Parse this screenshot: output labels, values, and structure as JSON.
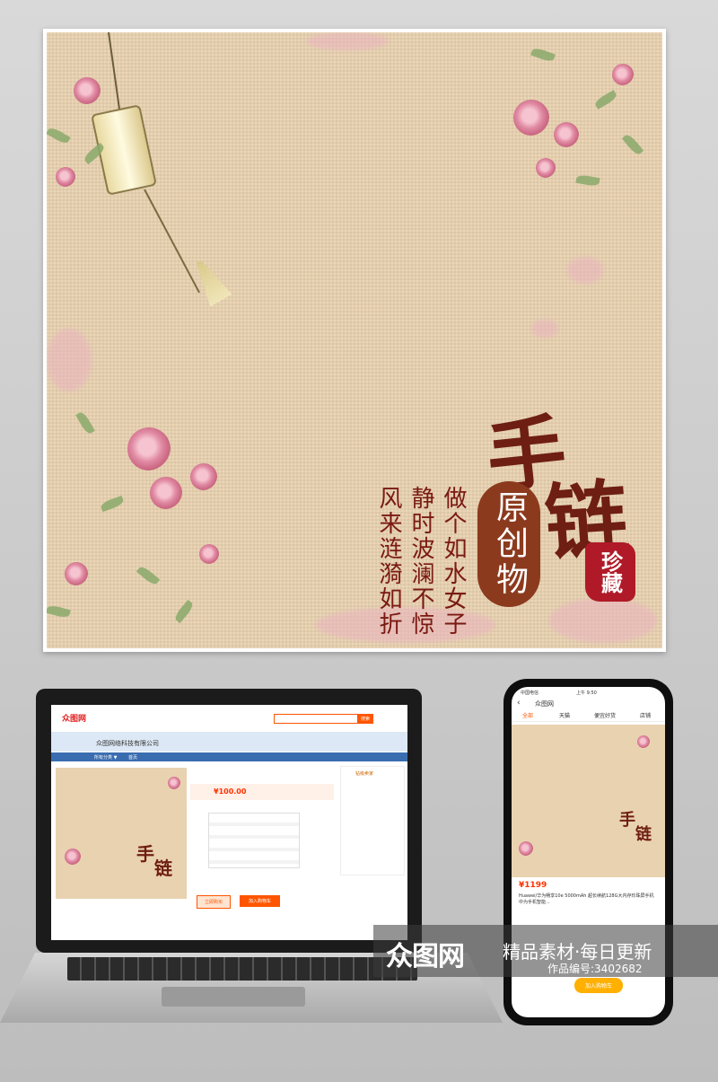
{
  "poster": {
    "title_char1": "手",
    "title_char2": "链",
    "circle_text": "原创物",
    "seal_text": "珍藏",
    "line1": "做个如水女子",
    "line2": "静时波澜不惊",
    "line3": "风来涟漪如折"
  },
  "laptop": {
    "logo": "众图网",
    "search_placeholder": "",
    "search_button": "搜索",
    "shop_name": "众图网络科技有限公司",
    "nav_items": [
      "所有分类 ▼",
      "首页"
    ],
    "price": "¥100.00",
    "buy_now": "立即购买",
    "add_cart": "加入购物车",
    "seller_label": "钻级卖家"
  },
  "phone": {
    "status_left": "中国电信",
    "status_time": "上午 9:50",
    "app_title": "众图网",
    "tabs": [
      "全部",
      "天猫",
      "便宜好货",
      "店铺"
    ],
    "price": "¥1199",
    "product_desc": "Huawei/华为畅享10e 5000mAh 超长续航128G大内存珍珠屏手机中为手机智能...",
    "buy_button": "加入购物车"
  },
  "watermark": {
    "brand": "众图网",
    "slogan": "精品素材·每日更新",
    "id_text": "作品编号:3402682"
  },
  "colors": {
    "poster_bg": "#e9d2b0",
    "title_red": "#6e1e12",
    "seal_red": "#b01a28",
    "accent_orange": "#ff5500"
  }
}
